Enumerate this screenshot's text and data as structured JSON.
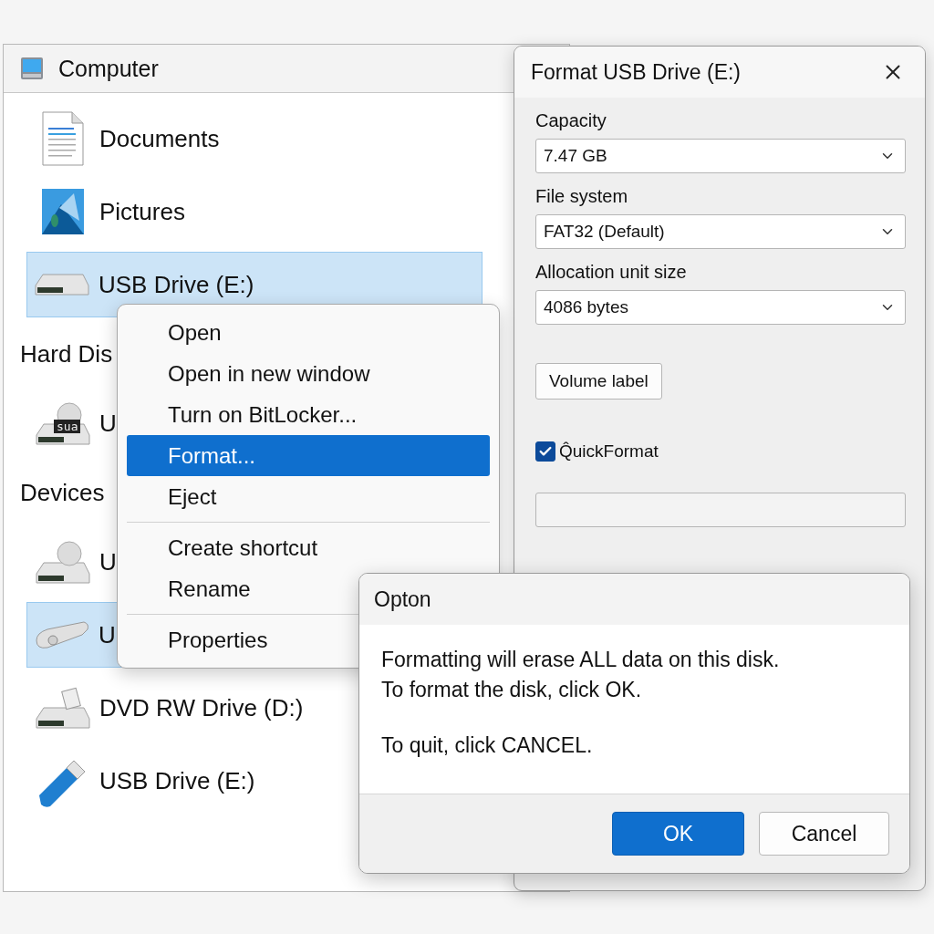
{
  "explorer": {
    "title": "Computer",
    "entries": [
      {
        "kind": "item",
        "label": "Documents",
        "selected": false
      },
      {
        "kind": "item",
        "label": "Pictures",
        "selected": false
      },
      {
        "kind": "item",
        "label": "USB Drive (E:)",
        "selected": true
      },
      {
        "kind": "header",
        "label": "Hard Dis"
      },
      {
        "kind": "item",
        "label": "U",
        "selected": false,
        "badge": "sua"
      },
      {
        "kind": "header",
        "label": "Devices"
      },
      {
        "kind": "item",
        "label": "U",
        "selected": false
      },
      {
        "kind": "item",
        "label": "U",
        "selected": true
      },
      {
        "kind": "item",
        "label": "DVD RW Drive (D:)",
        "selected": false
      },
      {
        "kind": "item",
        "label": "USB Drive (E:)",
        "selected": false
      }
    ]
  },
  "format_dialog": {
    "title": "Format USB Drive (E:)",
    "fields": [
      {
        "label": "Capacity",
        "value": "7.47 GB"
      },
      {
        "label": "File system",
        "value": "FAT32 (Default)"
      },
      {
        "label": "Allocation unit size",
        "value": "4086 bytes"
      }
    ],
    "volume_label_button": "Volume label",
    "quick_format": {
      "label": "Q̂uickFormat",
      "checked": true
    },
    "progress": {
      "level": 0
    }
  },
  "context_menu": {
    "groups": [
      [
        {
          "label": "Open",
          "selected": false
        },
        {
          "label": "Open in new window",
          "selected": false
        },
        {
          "label": "Turn on BitLocker...",
          "selected": false
        },
        {
          "label": "Format...",
          "selected": true
        },
        {
          "label": "Eject",
          "selected": false
        }
      ],
      [
        {
          "label": "Create shortcut",
          "selected": false
        },
        {
          "label": "Rename",
          "selected": false
        }
      ],
      [
        {
          "label": "Properties",
          "selected": false
        }
      ]
    ]
  },
  "message_dialog": {
    "title": "Opton",
    "paragraphs": [
      [
        "Formatting will erase ALL data on this disk.",
        "To format the disk, click OK."
      ],
      [
        "To quit, click CANCEL."
      ]
    ],
    "buttons": [
      {
        "label": "OK",
        "primary": true
      },
      {
        "label": "Cancel",
        "primary": false
      }
    ]
  }
}
